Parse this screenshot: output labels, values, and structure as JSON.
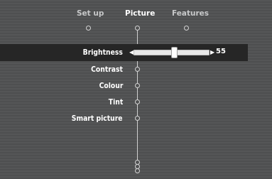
{
  "tabs": [
    {
      "label": "Set up",
      "active": false
    },
    {
      "label": "Picture",
      "active": true
    },
    {
      "label": "Features",
      "active": false
    }
  ],
  "menu": {
    "items": [
      {
        "label": "Brightness",
        "selected": true
      },
      {
        "label": "Contrast",
        "selected": false
      },
      {
        "label": "Colour",
        "selected": false
      },
      {
        "label": "Tint",
        "selected": false
      },
      {
        "label": "Smart picture",
        "selected": false
      }
    ]
  },
  "slider": {
    "value": "55",
    "level": 0.55
  },
  "icons": {
    "left_arrow": "arrow-left-icon",
    "right_arrow": "arrow-right-icon"
  },
  "colors": {
    "background": "#525354",
    "selection_band": "#262626",
    "text": "#ffffff"
  }
}
